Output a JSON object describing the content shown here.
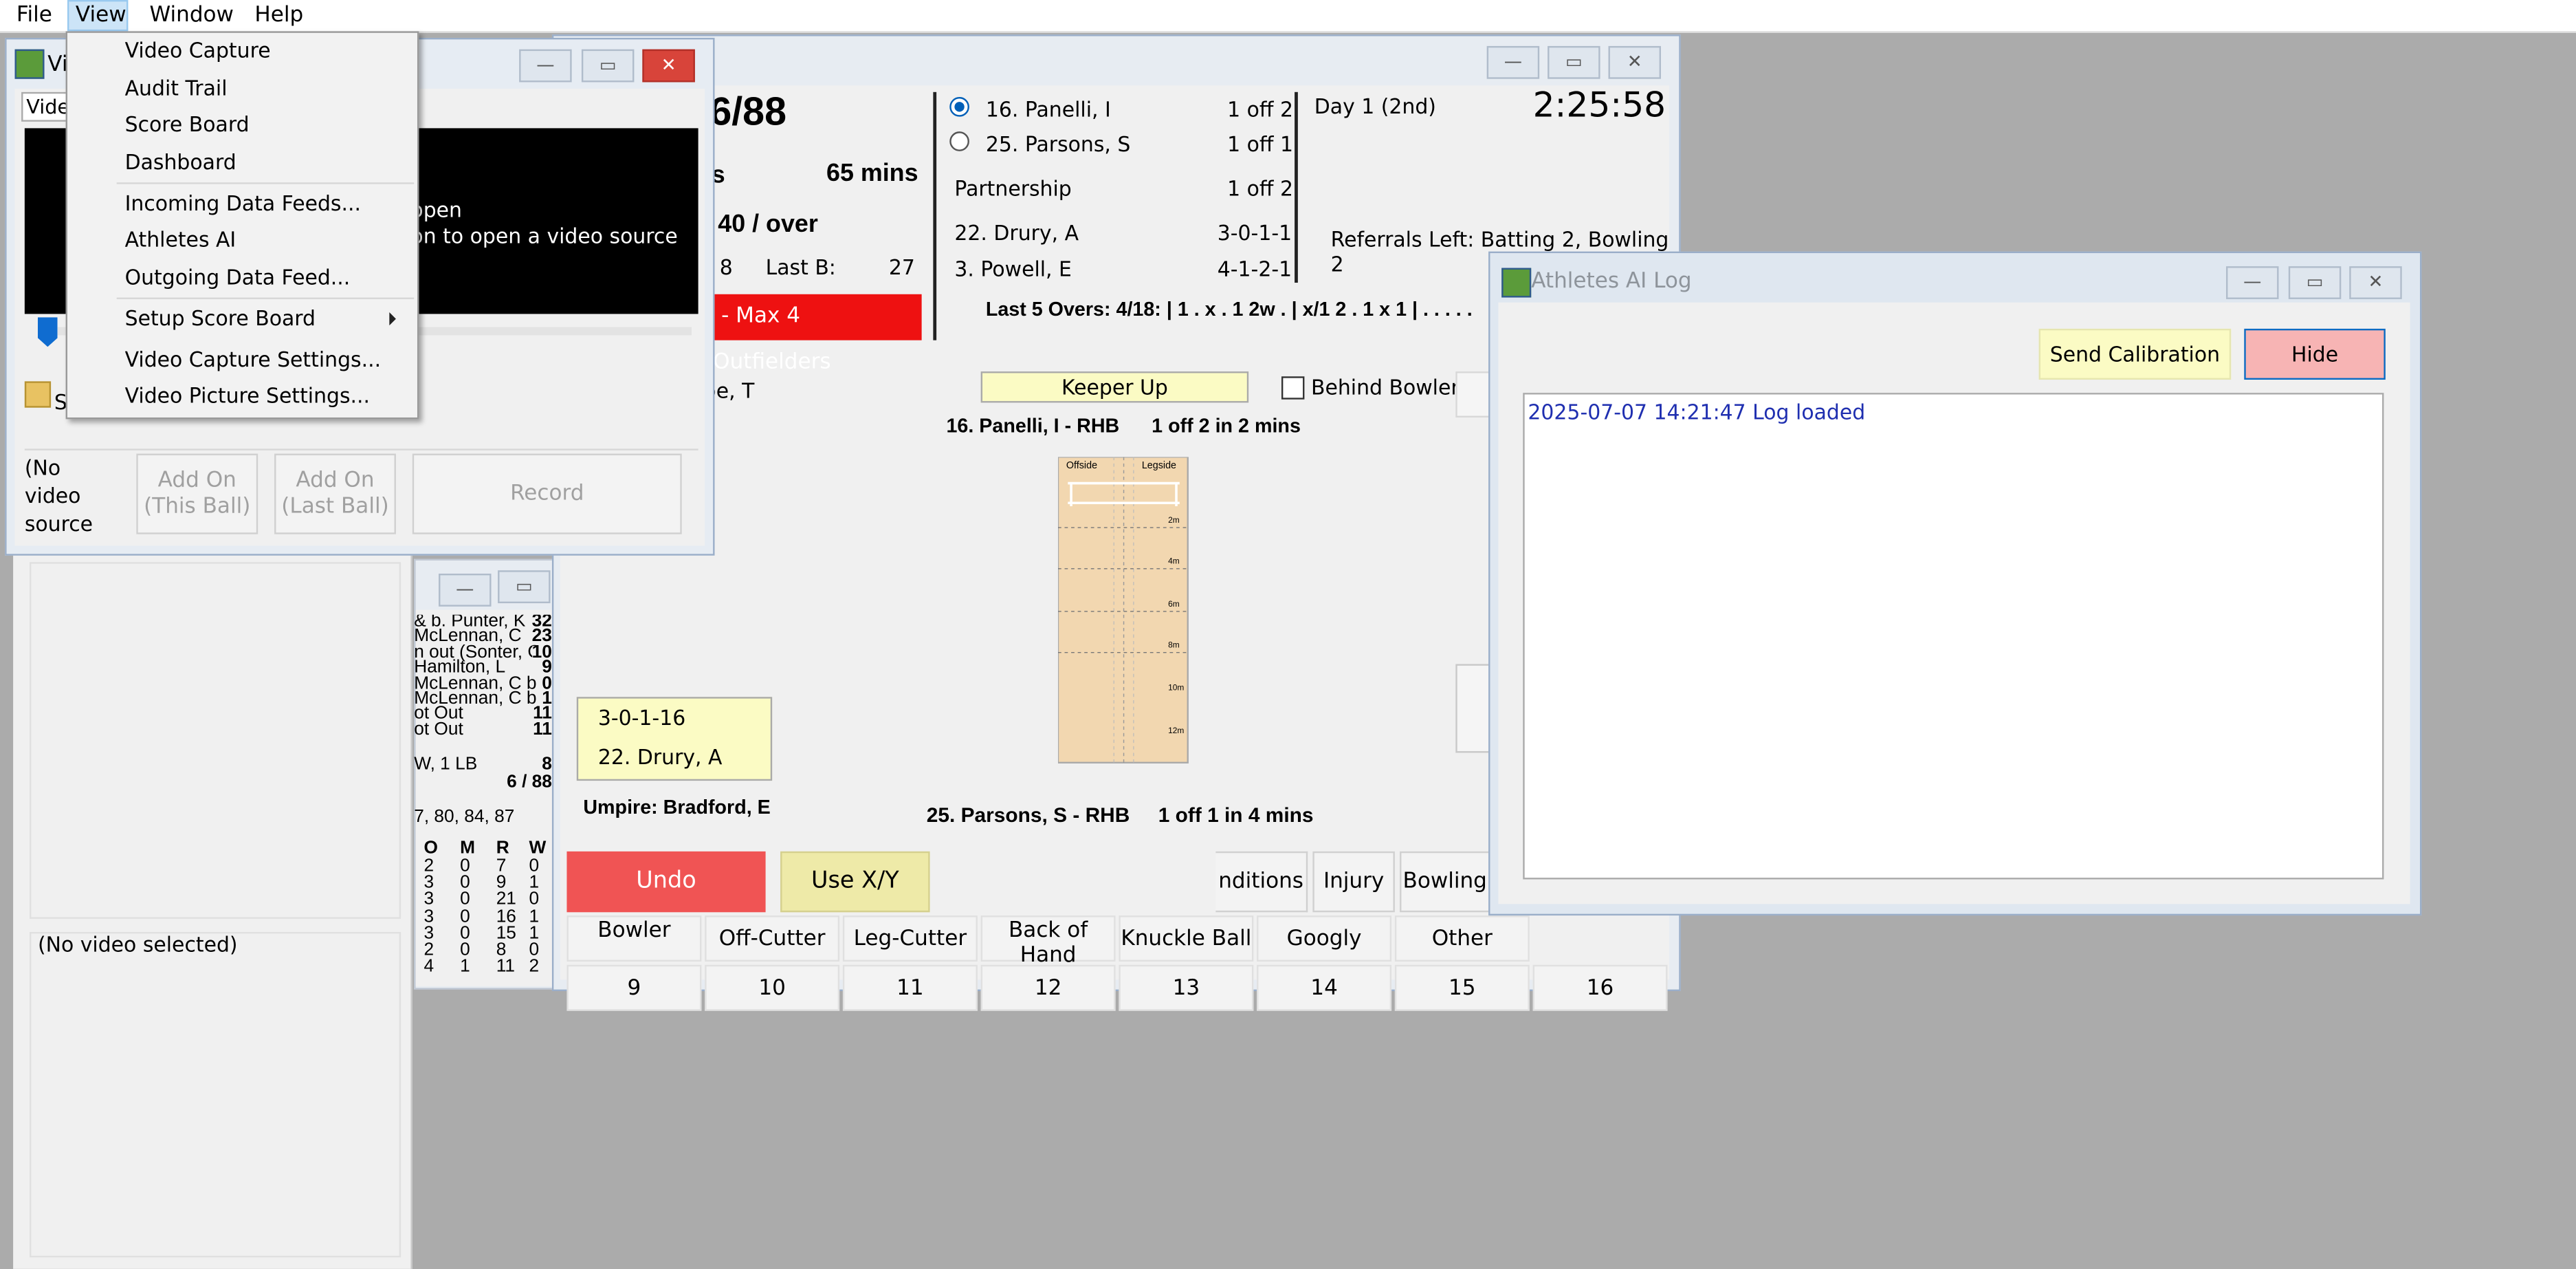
{
  "menubar": {
    "file": "File",
    "view": "View",
    "window": "Window",
    "help": "Help"
  },
  "view_menu": {
    "items": [
      "Video Capture",
      "Audit Trail",
      "Score Board",
      "Dashboard",
      "Incoming Data Feeds...",
      "Athletes AI",
      "Outgoing Data Feed...",
      "Setup Score Board",
      "Video Capture Settings...",
      "Video Picture Settings..."
    ]
  },
  "video_window": {
    "title_fragment": "Vi",
    "combo_fragment": "Vide",
    "folder_fragment": "S",
    "overlay_line1": "open",
    "overlay_line2": "on to open a video source",
    "no_source": [
      "(No",
      "video",
      "source"
    ],
    "add_on_this": [
      "Add On",
      "(This Ball)"
    ],
    "add_on_last": [
      "Add On",
      "(Last Ball)"
    ],
    "record": "Record",
    "no_video_selected": "(No video selected)"
  },
  "scorecard_window": {
    "batters": [
      "& b. Punter, K",
      "McLennan, C",
      "n out (Sonter, G",
      "Hamilton, L",
      "McLennan, C b",
      "McLennan, C b",
      "ot Out",
      "ot Out"
    ],
    "batter_runs": [
      "32",
      "23",
      "10",
      "9",
      "0",
      "1",
      "11",
      "11"
    ],
    "extras_label": "W, 1 LB",
    "extras_value": "8",
    "total": "6 / 88",
    "fow": "7, 80, 84, 87",
    "bowling_headers": [
      "O",
      "M",
      "R",
      "W"
    ],
    "bowling_rows": [
      [
        "2",
        "0",
        "7",
        "0"
      ],
      [
        "3",
        "0",
        "9",
        "1"
      ],
      [
        "3",
        "0",
        "21",
        "0"
      ],
      [
        "3",
        "0",
        "16",
        "1"
      ],
      [
        "3",
        "0",
        "15",
        "1"
      ],
      [
        "2",
        "0",
        "8",
        "0"
      ],
      [
        "4",
        "1",
        "11",
        "2"
      ]
    ]
  },
  "main": {
    "score_fragment": "6/88",
    "s_fragment": "s",
    "mins": "65 mins",
    "rate_fragment": "40 / over",
    "b8": "8",
    "last_b_label": "Last B:",
    "last_b_value": "27",
    "fielders_banner": "- Max 4 Outfielders",
    "striker_name": "16. Panelli, I",
    "striker_fig": "1 off 2",
    "nonstriker_name": "25. Parsons, S",
    "nonstriker_fig": "1 off 1",
    "partnership_label": "Partnership",
    "partnership_fig": "1 off 2",
    "bowler1_name": "22. Drury, A",
    "bowler1_fig": "3-0-1-1",
    "bowler2_name": "3. Powell, E",
    "bowler2_fig": "4-1-2-1",
    "day": "Day 1 (2nd)",
    "clock": "2:25:58",
    "referrals": "Referrals Left: Batting 2, Bowling 2",
    "last5": "Last 5 Overs:  4/18: | 1 . x . 1 2w . | x/1 2 . 1 x 1 | . . . . .",
    "keeper_up": "Keeper Up",
    "behind_bowler": "Behind Bowler?",
    "be_t": "be, T",
    "striker_line": "16. Panelli, I - RHB",
    "striker_line_fig": "1 off 2 in 2 mins",
    "pitch_offside": "Offside",
    "pitch_legside": "Legside",
    "pitch_marks": [
      "2m",
      "4m",
      "6m",
      "8m",
      "10m",
      "12m"
    ],
    "bowler_box_fig": "3-0-1-16",
    "bowler_box_name": "22. Drury, A",
    "umpire": "Umpire: Bradford, E",
    "nonstriker_line": "25. Parsons, S - RHB",
    "nonstriker_line_fig": "1 off 1 in 4 mins",
    "undo": "Undo",
    "use_xy": "Use X/Y",
    "conditions": "nditions",
    "injury": "Injury",
    "bowling": "Bowling",
    "delivery_types": [
      "Bowler",
      "Off-Cutter",
      "Leg-Cutter",
      "Back of Hand",
      "Knuckle Ball",
      "Googly",
      "Other"
    ],
    "numbers": [
      "9",
      "10",
      "11",
      "12",
      "13",
      "14",
      "15",
      "16"
    ]
  },
  "ai_log": {
    "title": "Athletes AI Log",
    "send_calibration": "Send Calibration",
    "hide": "Hide",
    "log_line": "2025-07-07 14:21:47 Log loaded"
  },
  "colors": {
    "undo": "#f05454",
    "use_xy": "#eeeaa8",
    "hide": "#f7b4b4",
    "send": "#fbfbc4",
    "keeper": "#fbfbc4",
    "banner": "#ee1111",
    "pitch": "#f2d7b0",
    "log_text": "#1f2fb0"
  }
}
